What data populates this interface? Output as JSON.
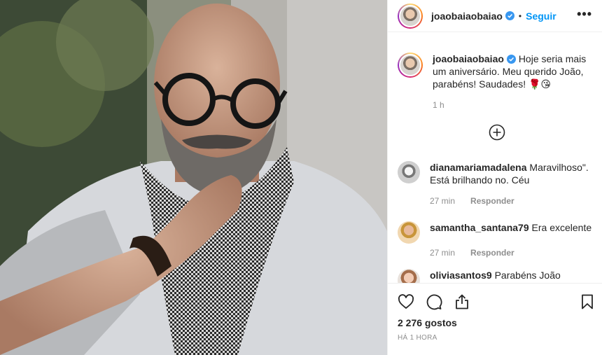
{
  "post": {
    "username": "joaobaiaobaiao",
    "follow_label": "Seguir",
    "separator": "•",
    "more_label": "•••",
    "caption": {
      "username": "joaobaiaobaiao",
      "text": "Hoje seria mais um aniversário. Meu querido João, parabéns! Saudades! 🌹😘",
      "time": "1 h"
    },
    "comments": [
      {
        "username": "dianamariamadalena",
        "text": "Maravilhoso\". Está brilhando no. Céu",
        "time": "27 min",
        "reply_label": "Responder"
      },
      {
        "username": "samantha_santana79",
        "text": "Era excelente",
        "time": "27 min",
        "reply_label": "Responder"
      },
      {
        "username": "oliviasantos9",
        "text": "Parabéns João"
      }
    ],
    "likes": "2 276 gostos",
    "posted_ago": "HÁ 1 HORA"
  },
  "colors": {
    "accent": "#0095f6",
    "muted": "#8e8e8e",
    "text": "#262626"
  }
}
